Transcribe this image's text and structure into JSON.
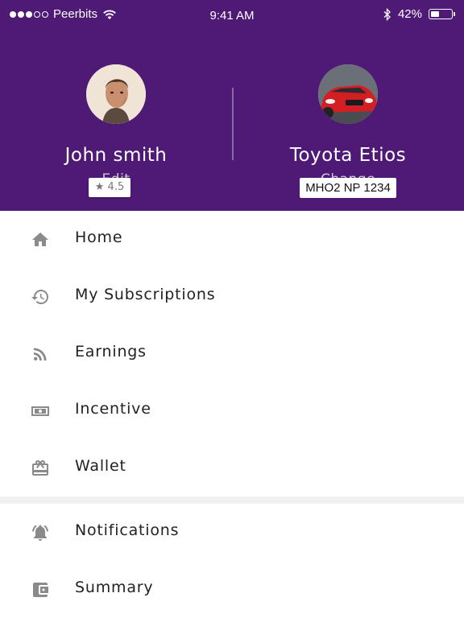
{
  "status_bar": {
    "carrier": "Peerbits",
    "time": "9:41 AM",
    "battery": "42%",
    "battery_level": 0.42
  },
  "driver": {
    "name": "John smith",
    "action": "Edit",
    "rating": "4.5"
  },
  "vehicle": {
    "plate": "MHO2 NP 1234",
    "name": "Toyota Etios",
    "action": "Change"
  },
  "menu": {
    "items": [
      {
        "label": "Home",
        "icon": "home-icon"
      },
      {
        "label": "My Subscriptions",
        "icon": "history-icon"
      },
      {
        "label": "Earnings",
        "icon": "rss-icon"
      },
      {
        "label": "Incentive",
        "icon": "money-icon"
      },
      {
        "label": "Wallet",
        "icon": "gift-card-icon"
      },
      {
        "label": "Notifications",
        "icon": "bell-icon"
      },
      {
        "label": "Summary",
        "icon": "wallet-icon"
      }
    ]
  },
  "colors": {
    "header": "#4f1a75",
    "icon": "#8a8a8a",
    "text": "#222222"
  }
}
